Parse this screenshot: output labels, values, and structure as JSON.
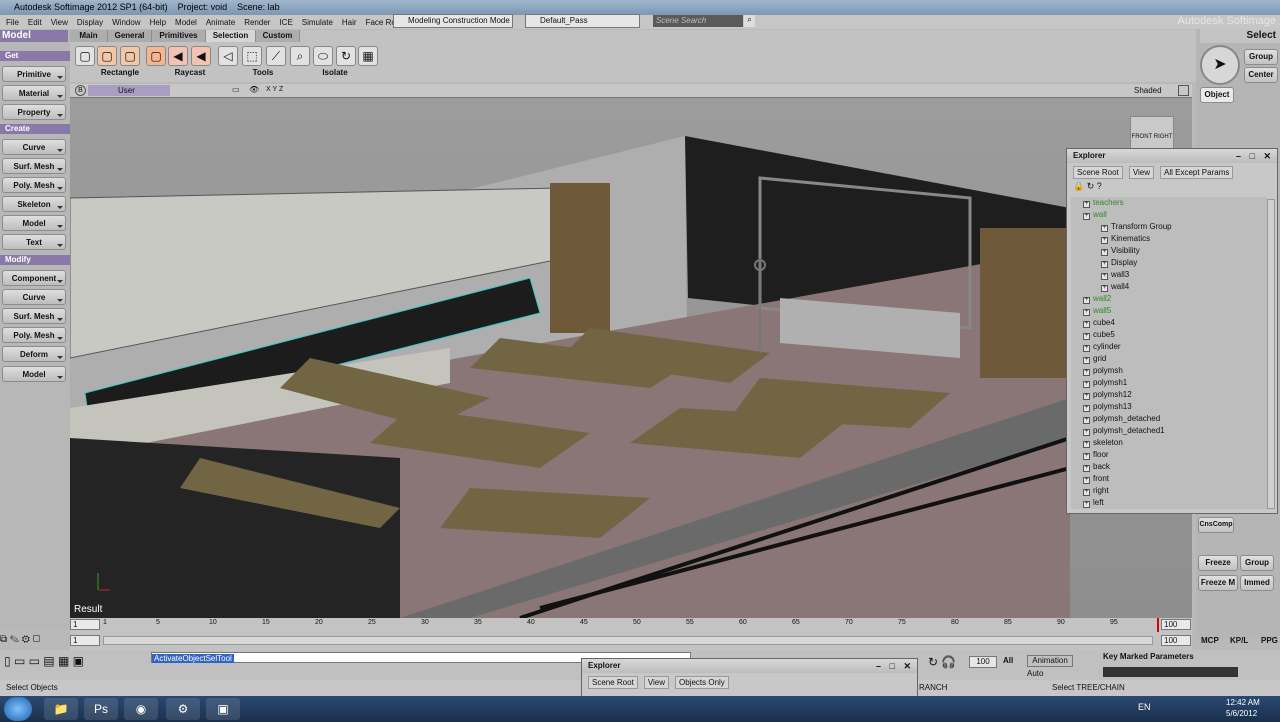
{
  "title": {
    "app": "Autodesk Softimage 2012 SP1 (64-bit)",
    "project": "Project: void",
    "scene": "Scene: lab",
    "brand": "Autodesk Softimage"
  },
  "menu": [
    "File",
    "Edit",
    "View",
    "Display",
    "Window",
    "Help",
    "Model",
    "Animate",
    "Render",
    "ICE",
    "Simulate",
    "Hair",
    "Face Robot"
  ],
  "mode_combo": "Modeling Construction Mode",
  "pass_combo": "Default_Pass",
  "search_placeholder": "Scene Search",
  "left": {
    "model_dd": "Model",
    "get": "Get",
    "get_items": [
      "Primitive",
      "Material",
      "Property"
    ],
    "create": "Create",
    "create_items": [
      "Curve",
      "Surf. Mesh",
      "Poly. Mesh",
      "Skeleton",
      "Model",
      "Text"
    ],
    "modify": "Modify",
    "modify_items": [
      "Component",
      "Curve",
      "Surf. Mesh",
      "Poly. Mesh",
      "Deform",
      "Model"
    ]
  },
  "tabs": [
    "Main",
    "General",
    "Primitives",
    "Selection",
    "Custom"
  ],
  "tool_labels": [
    "Rectangle",
    "Raycast",
    "Tools",
    "Isolate"
  ],
  "viewport": {
    "camera": "User",
    "axes": "X Y Z",
    "mode": "Shaded",
    "result": "Result"
  },
  "right": {
    "select": "Select",
    "group": "Group",
    "center": "Center",
    "object": "Object",
    "freeze": "Freeze",
    "group2": "Group",
    "freeze_m": "Freeze M",
    "immed": "Immed",
    "cnscomp": "CnsComp"
  },
  "explorer": {
    "title": "Explorer",
    "scene_root": "Scene Root",
    "view": "View",
    "filter": "All Except Params",
    "nodes": [
      {
        "label": "teachers",
        "color": "green",
        "indent": 0
      },
      {
        "label": "wall",
        "color": "green",
        "indent": 0
      },
      {
        "label": "Transform Group",
        "color": "",
        "indent": 1
      },
      {
        "label": "Kinematics",
        "color": "",
        "indent": 1
      },
      {
        "label": "Visibility",
        "color": "",
        "indent": 1
      },
      {
        "label": "Display",
        "color": "",
        "indent": 1
      },
      {
        "label": "wall3",
        "color": "",
        "indent": 1
      },
      {
        "label": "wall4",
        "color": "",
        "indent": 1
      },
      {
        "label": "wall2",
        "color": "green",
        "indent": 0
      },
      {
        "label": "wall5",
        "color": "green",
        "indent": 0
      },
      {
        "label": "cube4",
        "color": "",
        "indent": 0
      },
      {
        "label": "cube5",
        "color": "",
        "indent": 0
      },
      {
        "label": "cylinder",
        "color": "",
        "indent": 0
      },
      {
        "label": "grid",
        "color": "",
        "indent": 0
      },
      {
        "label": "polymsh",
        "color": "",
        "indent": 0
      },
      {
        "label": "polymsh1",
        "color": "",
        "indent": 0
      },
      {
        "label": "polymsh12",
        "color": "",
        "indent": 0
      },
      {
        "label": "polymsh13",
        "color": "",
        "indent": 0
      },
      {
        "label": "polymsh_detached",
        "color": "",
        "indent": 0
      },
      {
        "label": "polymsh_detached1",
        "color": "",
        "indent": 0
      },
      {
        "label": "skeleton",
        "color": "",
        "indent": 0
      },
      {
        "label": "floor",
        "color": "",
        "indent": 0
      },
      {
        "label": "back",
        "color": "",
        "indent": 0
      },
      {
        "label": "front",
        "color": "",
        "indent": 0
      },
      {
        "label": "right",
        "color": "",
        "indent": 0
      },
      {
        "label": "left",
        "color": "",
        "indent": 0
      }
    ]
  },
  "explorer2": {
    "title": "Explorer",
    "scene_root": "Scene Root",
    "view": "View",
    "filter": "Objects Only"
  },
  "timeline": {
    "start": "1",
    "end": "100",
    "end2": "100",
    "ticks": [
      "1",
      "5",
      "10",
      "15",
      "20",
      "25",
      "30",
      "35",
      "40",
      "45",
      "50",
      "55",
      "60",
      "65",
      "70",
      "75",
      "80",
      "85",
      "90",
      "95"
    ],
    "mcp": "MCP",
    "kpl": "KP/L",
    "ppg": "PPG"
  },
  "cmd": {
    "text": "ActivateObjectSelTool",
    "frame": "100",
    "all": "All",
    "animation": "Animation",
    "auto": "Auto",
    "keymarked": "Key Marked Parameters"
  },
  "status": {
    "left": "Select Objects",
    "mid": "RANCH",
    "right": "Select TREE/CHAIN"
  },
  "taskbar": {
    "lang": "EN",
    "time": "12:42 AM",
    "date": "5/6/2012"
  }
}
